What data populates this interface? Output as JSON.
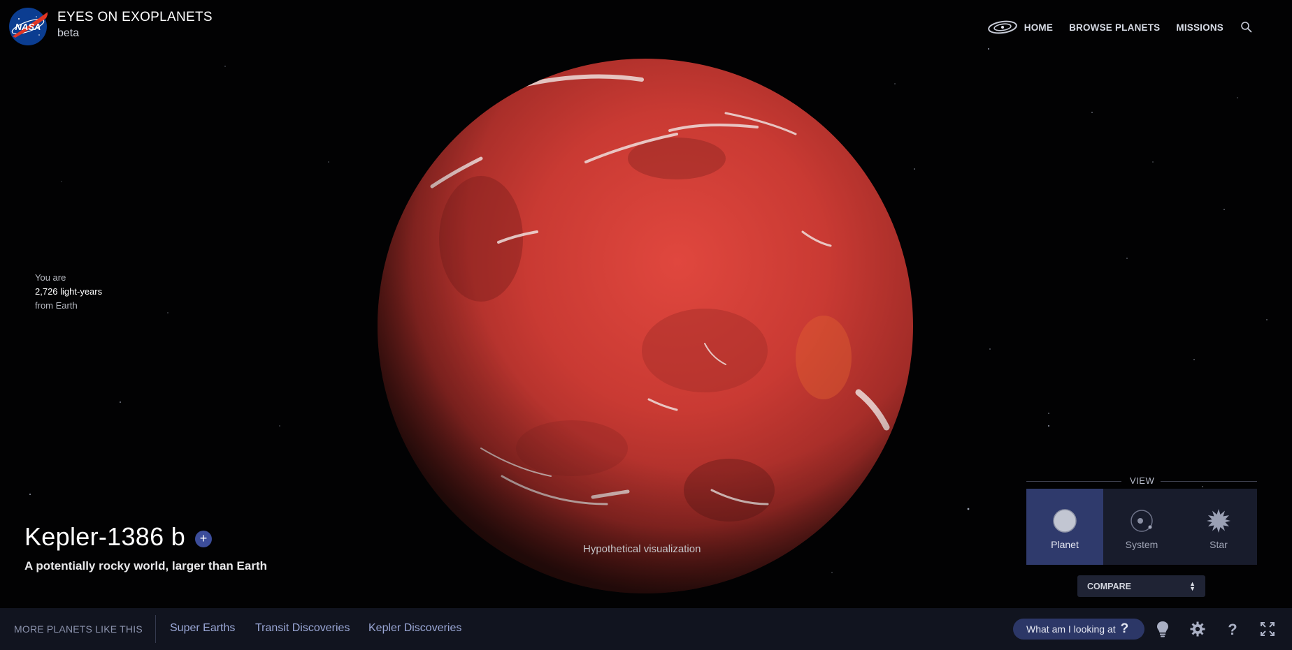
{
  "header": {
    "title": "EYES ON EXOPLANETS",
    "subtitle": "beta",
    "nav": [
      "HOME",
      "BROWSE PLANETS",
      "MISSIONS"
    ],
    "icons": [
      "nasa-logo",
      "galaxy-icon",
      "search-icon"
    ]
  },
  "distance": {
    "prefix": "You are",
    "value": "2,726 light-years",
    "suffix": "from Earth"
  },
  "planet": {
    "name": "Kepler-1386 b",
    "add_symbol": "+",
    "tagline": "A potentially rocky world, larger than Earth",
    "visualization_note": "Hypothetical visualization"
  },
  "view": {
    "label": "VIEW",
    "options": [
      "Planet",
      "System",
      "Star"
    ],
    "selected": "Planet"
  },
  "compare": {
    "label": "COMPARE"
  },
  "bottom_bar": {
    "more_label": "MORE PLANETS LIKE THIS",
    "links": [
      "Super Earths",
      "Transit Discoveries",
      "Kepler Discoveries"
    ],
    "help_button": "What am I looking at",
    "help_symbol": "?",
    "icons": [
      "lightbulb-icon",
      "gear-icon",
      "help-icon",
      "fullscreen-icon"
    ]
  },
  "colors": {
    "background": "#020203",
    "accent": "#2f3a6c",
    "planet": "#c93a33",
    "bottom_bar": "#11141f"
  }
}
